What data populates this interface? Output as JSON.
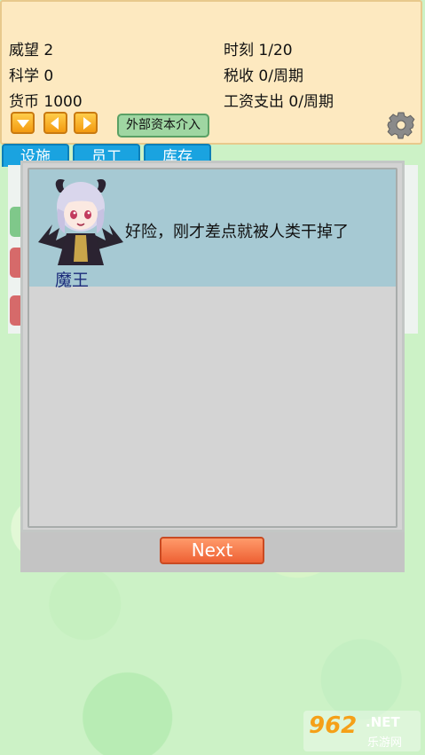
{
  "stats": {
    "prestige": "威望 2",
    "science": "科学 0",
    "currency": "货币 1000",
    "time": "时刻 1/20",
    "tax": "税收 0/周期",
    "wages": "工资支出 0/周期"
  },
  "toolbar": {
    "capital_label": "外部资本介入"
  },
  "tabs": [
    "设施",
    "员工",
    "库存"
  ],
  "dialog": {
    "speaker": "魔王",
    "text": "好险，刚才差点就被人类干掉了",
    "next_label": "Next"
  },
  "watermark": {
    "number": "962",
    "net": ".NET",
    "site": "乐游网"
  },
  "colors": {
    "header_bg": "#fde9c0",
    "tab_blue": "#1aa3e0",
    "next_orange": "#ee6134",
    "speaker_band": "#a6c9d3"
  }
}
